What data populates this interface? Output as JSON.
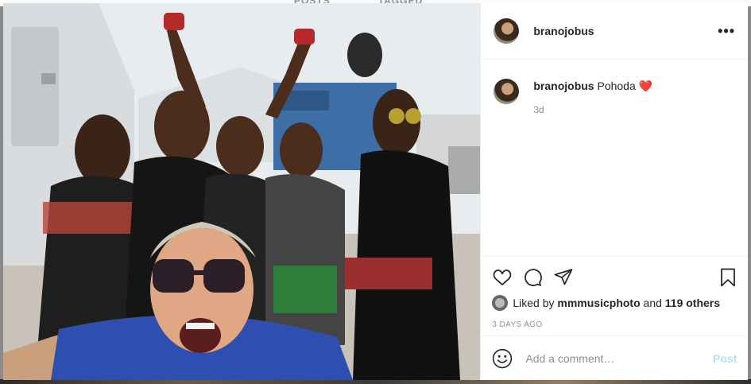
{
  "background": {
    "tabs": [
      "POSTS",
      "TAGGED"
    ]
  },
  "post": {
    "author": "branojobus",
    "caption_user": "branojobus",
    "caption_text": "Pohoda",
    "caption_emoji": "❤️",
    "caption_age": "3d",
    "liked_by_prefix": "Liked by",
    "liked_by_user": "mmmusicphoto",
    "liked_by_and": "and",
    "liked_by_others": "119 others",
    "posted_ago": "3 DAYS AGO"
  },
  "comment": {
    "placeholder": "Add a comment…",
    "post_label": "Post"
  },
  "icons": {
    "more": "more-icon",
    "like": "heart-icon",
    "comment": "comment-icon",
    "share": "share-icon",
    "save": "bookmark-icon",
    "emoji": "emoji-icon"
  },
  "colors": {
    "text": "#262626",
    "secondary": "#8e8e8e",
    "post_button_disabled": "#b2dffc",
    "heart": "#ed4956"
  }
}
